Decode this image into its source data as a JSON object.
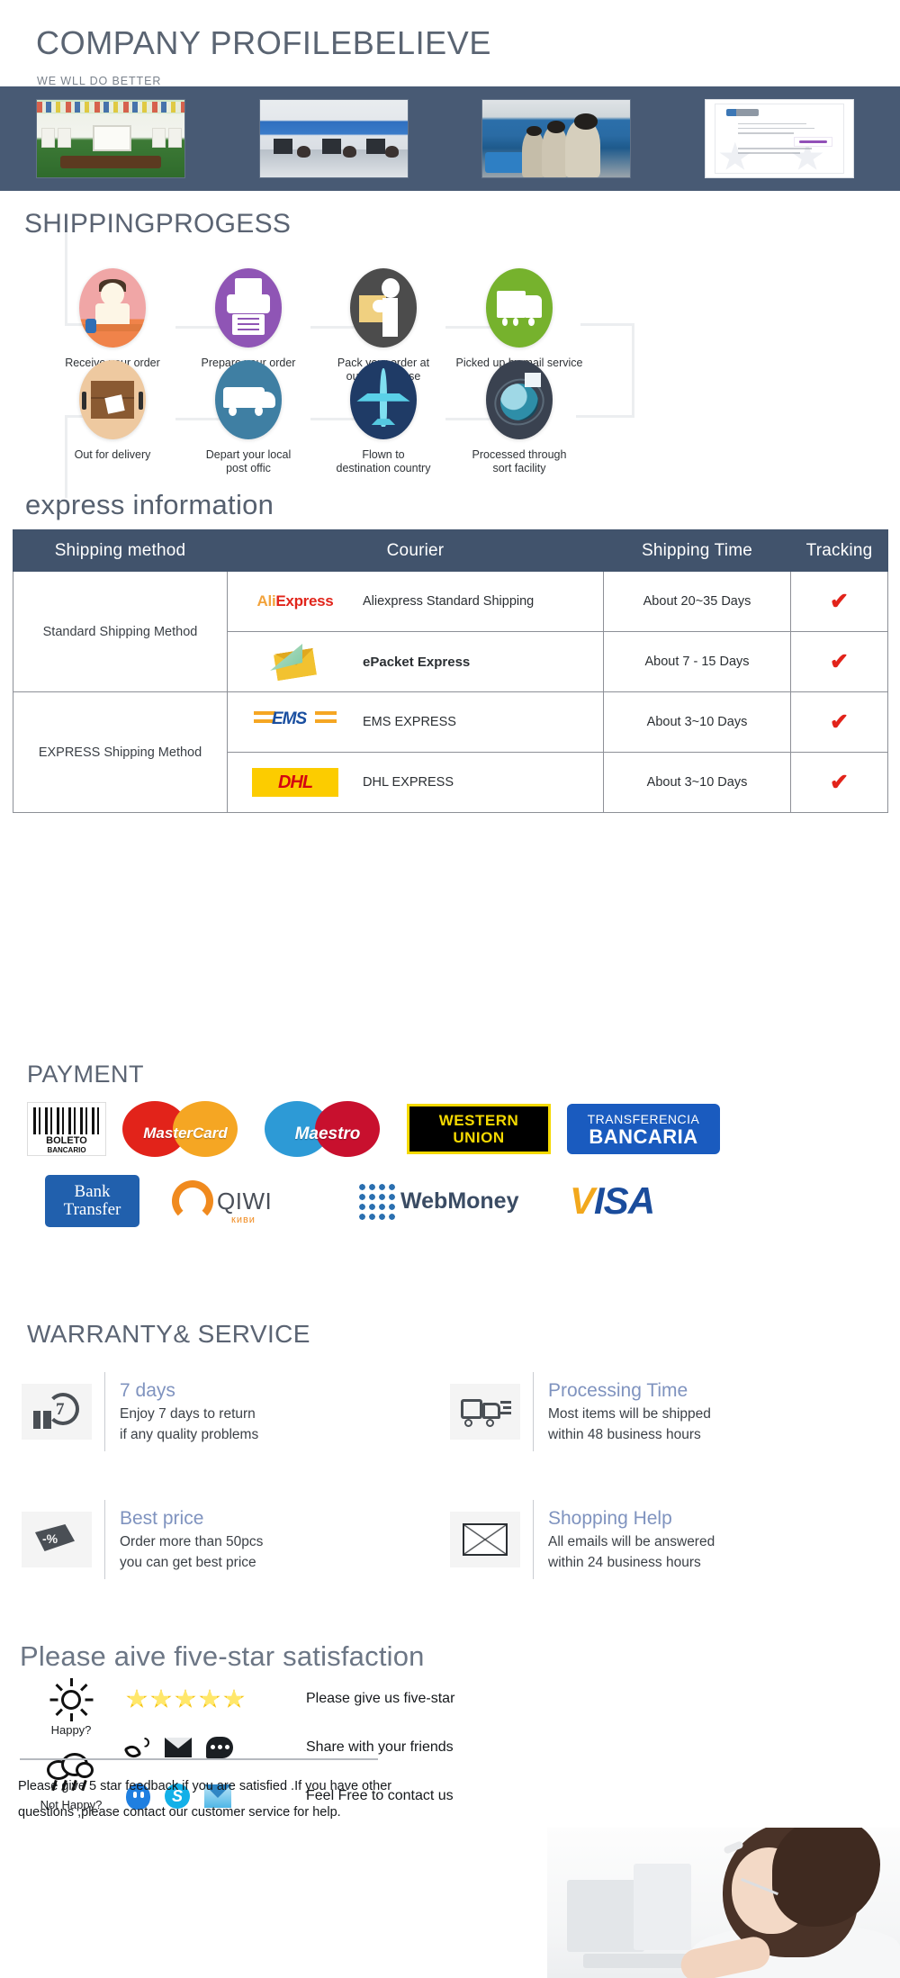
{
  "header": {
    "title": "COMPANY PROFILEBELIEVE",
    "subtitle": "WE WLL DO BETTER"
  },
  "banner": {
    "images": [
      {
        "alt": "showroom-photo"
      },
      {
        "alt": "office-photo"
      },
      {
        "alt": "production-line-photo"
      },
      {
        "alt": "certificate-photo"
      }
    ]
  },
  "shipping_progress": {
    "title": "SHIPPINGPROGESS",
    "steps": [
      {
        "label": "Receive your order",
        "icon": "person-icon",
        "color": "#f0a6a6"
      },
      {
        "label": "Prepare your order",
        "icon": "printer-icon",
        "color": "#8f55b5"
      },
      {
        "label": "Pack your order at\nour warehouse",
        "line1": "Pack your order at",
        "line2": "our warehouse",
        "icon": "package-worker-icon",
        "color": "#4c4c4c"
      },
      {
        "label": "Picked up by mail service",
        "icon": "truck-icon",
        "color": "#76b22d"
      },
      {
        "label": "Out for delivery",
        "icon": "carton-icon",
        "color": "#eec9a0"
      },
      {
        "label": "Depart your local\npost offic",
        "line1": "Depart your local",
        "line2": "post offic",
        "icon": "van-icon",
        "color": "#3f7fa3"
      },
      {
        "label": "Flown to\ndestination country",
        "line1": "Flown to",
        "line2": "destination country",
        "icon": "airplane-icon",
        "color": "#1f3b66"
      },
      {
        "label": "Processed through\nsort facility",
        "line1": "Processed through",
        "line2": "sort facility",
        "icon": "globe-sort-icon",
        "color": "#3a4250"
      }
    ]
  },
  "express": {
    "title": "express information",
    "columns": [
      "Shipping method",
      "Courier",
      "Shipping Time",
      "Tracking"
    ],
    "groups": [
      {
        "method": "Standard Shipping Method",
        "rows": [
          {
            "logo": "aliexpress-logo",
            "logo_text_a": "Ali",
            "logo_text_b": "Express",
            "courier": "Aliexpress Standard Shipping",
            "time": "About 20~35 Days",
            "tracking": "✔"
          },
          {
            "logo": "epacket-logo",
            "courier": "ePacket Express",
            "time": "About 7 - 15 Days",
            "tracking": "✔"
          }
        ]
      },
      {
        "method": "EXPRESS Shipping Method",
        "rows": [
          {
            "logo": "ems-logo",
            "logo_text": "EMS",
            "courier": "EMS EXPRESS",
            "time": "About 3~10 Days",
            "tracking": "✔"
          },
          {
            "logo": "dhl-logo",
            "logo_text": "DHL",
            "courier": "DHL EXPRESS",
            "time": "About 3~10 Days",
            "tracking": "✔"
          }
        ]
      }
    ]
  },
  "payment": {
    "title": "PAYMENT",
    "methods_row1": [
      {
        "name": "Boleto Bancario",
        "line1": "BOLETO",
        "line2": "BANCARIO"
      },
      {
        "name": "MasterCard",
        "label": "MasterCard"
      },
      {
        "name": "Maestro",
        "label": "Maestro"
      },
      {
        "name": "Western Union",
        "line1": "WESTERN",
        "line2": "UNION"
      },
      {
        "name": "Transferencia Bancaria",
        "line1": "TRANSFERENCIA",
        "line2": "BANCARIA"
      }
    ],
    "methods_row2": [
      {
        "name": "Bank Transfer",
        "line1": "Bank",
        "line2": "Transfer"
      },
      {
        "name": "QIWI",
        "label": "QIWI",
        "sub": "киви"
      },
      {
        "name": "WebMoney",
        "label": "WebMoney"
      },
      {
        "name": "VISA",
        "label_v": "V",
        "label_rest": "ISA"
      }
    ]
  },
  "warranty": {
    "title": "WARRANTY& SERVICE",
    "items": [
      {
        "icon": "seven-days-icon",
        "heading": "7 days",
        "line1": "Enjoy 7 days to return",
        "line2": "if any quality problems"
      },
      {
        "icon": "delivery-truck-icon",
        "heading": "Processing Time",
        "line1": "Most items will be shipped",
        "line2": "within 48 business hours"
      },
      {
        "icon": "discount-percent-icon",
        "heading": "Best price",
        "line1": "Order more than 50pcs",
        "line2": "you can get best price"
      },
      {
        "icon": "envelope-icon",
        "heading": "Shopping Help",
        "line1": "All emails will be answered",
        "line2": "within 24 business hours"
      }
    ]
  },
  "five_star": {
    "title": "Please aive five-star satisfaction",
    "moods": [
      {
        "icon": "sun-icon",
        "label": "Happy?"
      },
      {
        "icon": "rain-cloud-icon",
        "label": "Not Happy?"
      }
    ],
    "rows": [
      {
        "icons": [
          "star-icon",
          "star-icon",
          "star-icon",
          "star-icon",
          "star-icon"
        ],
        "label": "Please give us five-star",
        "star_count": 5
      },
      {
        "icons": [
          "phone-icon",
          "mail-icon",
          "chat-icon"
        ],
        "label": "Share with your friends"
      },
      {
        "icons": [
          "qq-icon",
          "skype-icon",
          "trademanager-icon"
        ],
        "label": "Feel Free to contact us"
      }
    ],
    "footer_line1": "Please give 5 star feedback if you are satisfied .If you have other",
    "footer_line2": "questions ,please contact our customer service for help.",
    "agent_image_alt": "customer-service-agent-photo"
  },
  "colors": {
    "banner_bg": "#485a74",
    "table_header_bg": "#41536c",
    "title_text": "#5b6473",
    "accent_blue": "#7f93bf",
    "check_red": "#e2231a"
  }
}
